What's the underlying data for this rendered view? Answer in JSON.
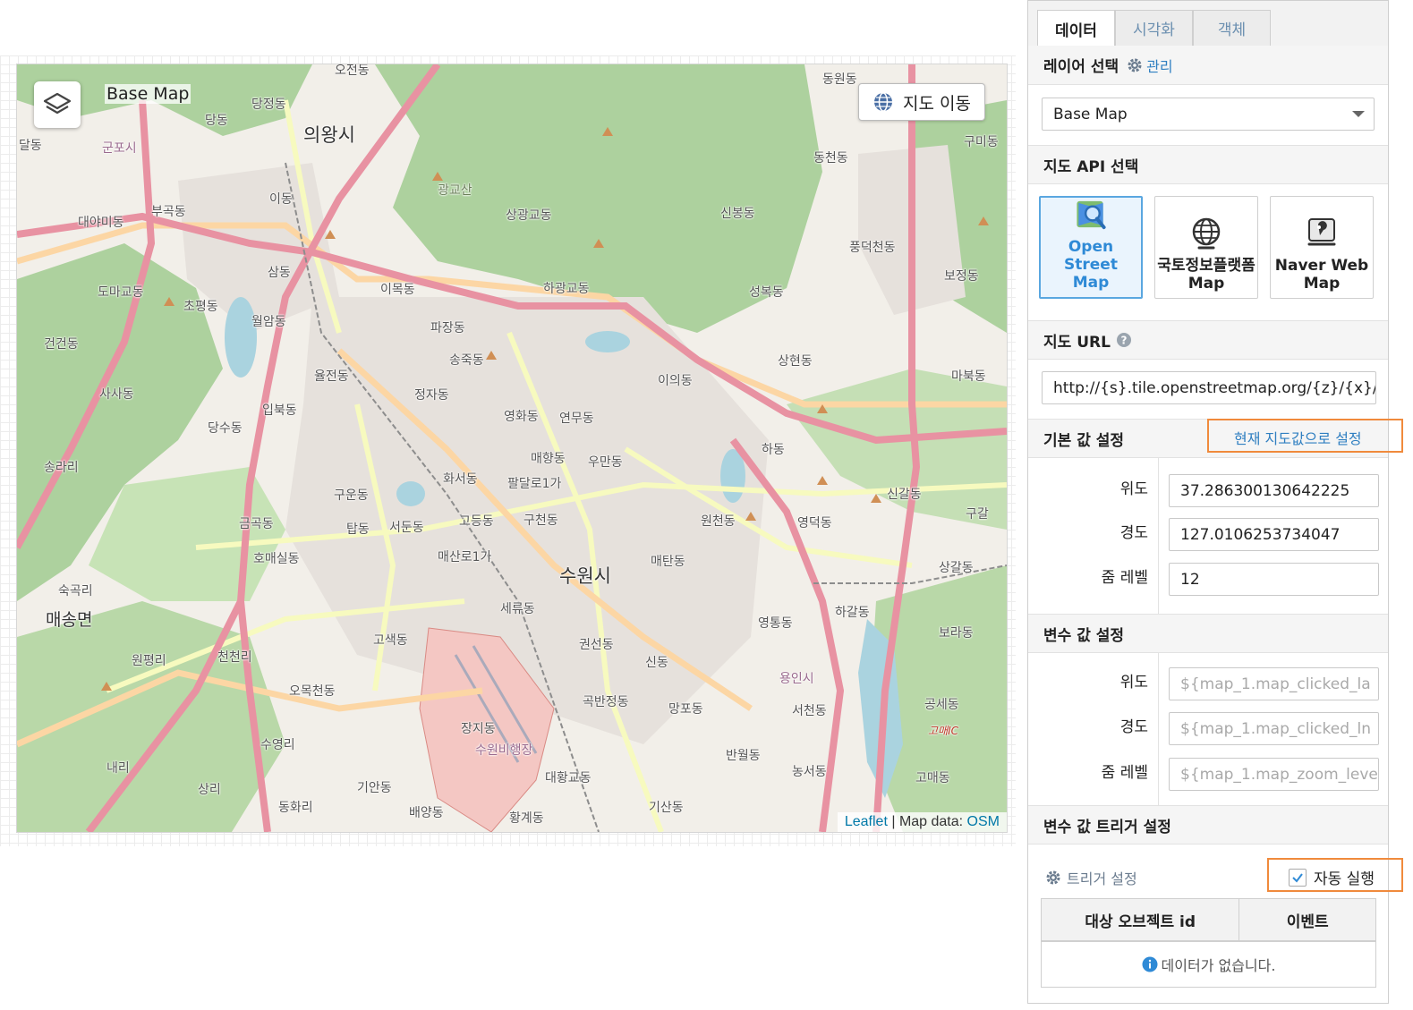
{
  "map": {
    "layer_name": "Base Map",
    "move_button_label": "지도 이동",
    "attribution_leaflet": "Leaflet",
    "attribution_sep": " | Map data: ",
    "attribution_osm": "OSM",
    "labels": {
      "suwon": "수원시",
      "uiwang": "의왕시",
      "maesong": "매송면",
      "gwanggyosan": "광교산",
      "danggok": "당정동",
      "odong": "오전동",
      "dangdong": "당동",
      "dongwon": "동원동",
      "gunpo": "군포시",
      "daldong": "달동",
      "idong": "이동",
      "bugok": "부곡동",
      "daeya": "대야미동",
      "samdong": "삼동",
      "doma": "도마교동",
      "chopyeong": "초평동",
      "wolam": "월암동",
      "geongeon": "건건동",
      "sasa": "사사동",
      "dangsu": "당수동",
      "ipbuk": "입북동",
      "yuljeon": "율전동",
      "imok": "이목동",
      "pajang": "파장동",
      "songjuk": "송죽동",
      "jeongja": "정자동",
      "yeonghwa": "영화동",
      "yeonmu": "연무동",
      "maehyang": "매향동",
      "umandong": "우만동",
      "hwaseo": "화서동",
      "paldal": "팔달로1가",
      "guun": "구운동",
      "tap": "탑동",
      "seodun": "서둔동",
      "godeung": "고등동",
      "gucheon": "구천동",
      "geumgok": "금곡동",
      "homae": "호매실동",
      "maesanro": "매산로1가",
      "sangwang": "상광교동",
      "hagwang": "하광교동",
      "sinbong": "신봉동",
      "pungdeok": "풍덕천동",
      "dongcheon": "동천동",
      "gumi": "구미동",
      "seongbok": "성복동",
      "boje": "보정동",
      "sanghyeon": "상현동",
      "iui": "이의동",
      "mabuk": "마북동",
      "hadong": "하동",
      "singal": "신갈동",
      "wonchon": "원천동",
      "yeongdeok": "영덕동",
      "maetan": "매탄동",
      "sanggal": "상갈동",
      "hagal": "하갈동",
      "yeongtong": "영통동",
      "sukgok": "숙곡리",
      "gosaek": "고색동",
      "omokcheon": "오목천동",
      "wonpyeong": "원평리",
      "cheoncheon": "천천리",
      "seryu": "세류동",
      "gwonseon": "권선동",
      "sindong": "신동",
      "gokban": "곡반정동",
      "mangpo": "망포동",
      "seocheon": "서천동",
      "jangji": "장지동",
      "airport": "수원비행장",
      "daehwang": "대황교동",
      "banwol": "반월동",
      "nongseo": "농서동",
      "gisan": "기산동",
      "hwanggye": "황계동",
      "giandong": "기안동",
      "baeyang": "배양동",
      "suyeong": "수영리",
      "naeri": "내리",
      "sangri": "상리",
      "donghwa": "동화리",
      "gongse": "공세동",
      "gomae": "고매동",
      "borado": "보라동",
      "yongin": "용인시",
      "giheung": "고매IC",
      "songdongri": "송라리",
      "gugal": "구갈"
    }
  },
  "panel": {
    "tabs": [
      "데이터",
      "시각화",
      "객체"
    ],
    "layer_select_title": "레이어 선택",
    "manage_label": "관리",
    "layer_select_value": "Base Map",
    "api_title": "지도 API 선택",
    "api_options": [
      {
        "line1": "Open Street",
        "line2": "Map",
        "active": true
      },
      {
        "line1": "국토정보플랫폼",
        "line2": "Map",
        "active": false
      },
      {
        "line1": "Naver Web",
        "line2": "Map",
        "active": false
      }
    ],
    "url_title": "지도 URL",
    "url_value": "http://{s}.tile.openstreetmap.org/{z}/{x}/{y}",
    "default_title": "기본 값 설정",
    "set_current_link": "현재 지도값으로 설정",
    "default_fields": [
      {
        "label": "위도",
        "value": "37.286300130642225"
      },
      {
        "label": "경도",
        "value": "127.0106253734047"
      },
      {
        "label": "줌 레벨",
        "value": "12"
      }
    ],
    "var_title": "변수 값 설정",
    "var_fields": [
      {
        "label": "위도",
        "placeholder": "${map_1.map_clicked_la"
      },
      {
        "label": "경도",
        "placeholder": "${map_1.map_clicked_ln"
      },
      {
        "label": "줌 레벨",
        "placeholder": "${map_1.map_zoom_leve"
      }
    ],
    "trigger_title": "변수 값 트리거 설정",
    "trigger_settings_label": "트리거 설정",
    "auto_run_label": "자동 실행",
    "auto_run_checked": true,
    "table_headers": [
      "대상 오브젝트 id",
      "이벤트"
    ],
    "empty_message": "데이터가 없습니다."
  },
  "colors": {
    "accent": "#2f8ad6",
    "highlight_box": "#f08a3c",
    "forest": "#add19e",
    "motorway": "#e892a2",
    "primary_road": "#fcd6a4",
    "water": "#aad3df"
  }
}
